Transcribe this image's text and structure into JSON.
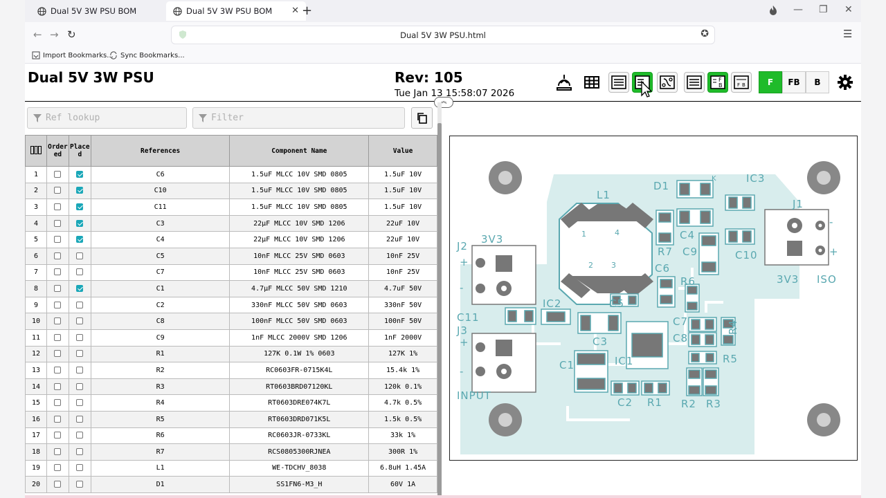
{
  "browser": {
    "tabs": [
      {
        "title": "Dual 5V 3W PSU BOM",
        "active": false
      },
      {
        "title": "Dual 5V 3W PSU BOM",
        "active": true
      }
    ],
    "url": "Dual 5V 3W PSU.html",
    "bookmarks": [
      "Import Bookmarks...",
      "Sync Bookmarks..."
    ]
  },
  "header": {
    "title": "Dual 5V 3W PSU",
    "revision": "Rev: 105",
    "date": "Tue Jan 13 15:58:07 2026"
  },
  "toolbar": {
    "layer_buttons": {
      "front": "F",
      "front_back": "FB",
      "back": "B"
    },
    "selected_layer": "F",
    "accent_color": "#1fbb2a"
  },
  "filters": {
    "ref_placeholder": "Ref lookup",
    "filter_placeholder": "Filter"
  },
  "bom": {
    "headers": {
      "ordered": "Ordered",
      "placed": "Placed",
      "references": "References",
      "component": "Component Name",
      "value": "Value"
    },
    "rows": [
      {
        "n": "1",
        "ordered": false,
        "placed": true,
        "ref": "C6",
        "name": "1.5uF MLCC 10V SMD 0805",
        "value": "1.5uF 10V"
      },
      {
        "n": "2",
        "ordered": false,
        "placed": true,
        "ref": "C10",
        "name": "1.5uF MLCC 10V SMD 0805",
        "value": "1.5uF 10V"
      },
      {
        "n": "3",
        "ordered": false,
        "placed": true,
        "ref": "C11",
        "name": "1.5uF MLCC 10V SMD 0805",
        "value": "1.5uF 10V"
      },
      {
        "n": "4",
        "ordered": false,
        "placed": true,
        "ref": "C3",
        "name": "22µF MLCC 10V SMD 1206",
        "value": "22uF 10V"
      },
      {
        "n": "5",
        "ordered": false,
        "placed": true,
        "ref": "C4",
        "name": "22µF MLCC 10V SMD 1206",
        "value": "22uF 10V"
      },
      {
        "n": "6",
        "ordered": false,
        "placed": false,
        "ref": "C5",
        "name": "10nF MLCC 25V SMD 0603",
        "value": "10nF 25V"
      },
      {
        "n": "7",
        "ordered": false,
        "placed": false,
        "ref": "C7",
        "name": "10nF MLCC 25V SMD 0603",
        "value": "10nF 25V"
      },
      {
        "n": "8",
        "ordered": false,
        "placed": true,
        "ref": "C1",
        "name": "4.7µF MLCC 50V SMD 1210",
        "value": "4.7uF 50V"
      },
      {
        "n": "9",
        "ordered": false,
        "placed": false,
        "ref": "C2",
        "name": "330nF MLCC 50V SMD 0603",
        "value": "330nF 50V"
      },
      {
        "n": "10",
        "ordered": false,
        "placed": false,
        "ref": "C8",
        "name": "100nF MLCC 50V SMD 0603",
        "value": "100nF 50V"
      },
      {
        "n": "11",
        "ordered": false,
        "placed": false,
        "ref": "C9",
        "name": "1nF MLCC 2000V SMD 1206",
        "value": "1nF 2000V"
      },
      {
        "n": "12",
        "ordered": false,
        "placed": false,
        "ref": "R1",
        "name": "127K 0.1W 1% 0603",
        "value": "127K 1%"
      },
      {
        "n": "13",
        "ordered": false,
        "placed": false,
        "ref": "R2",
        "name": "RC0603FR-0715K4L",
        "value": "15.4k 1%"
      },
      {
        "n": "14",
        "ordered": false,
        "placed": false,
        "ref": "R3",
        "name": "RT0603BRD07120KL",
        "value": "120k 0.1%"
      },
      {
        "n": "15",
        "ordered": false,
        "placed": false,
        "ref": "R4",
        "name": "RT0603DRE074K7L",
        "value": "4.7k 0.5%"
      },
      {
        "n": "16",
        "ordered": false,
        "placed": false,
        "ref": "R5",
        "name": "RT0603DRD071K5L",
        "value": "1.5k 0.5%"
      },
      {
        "n": "17",
        "ordered": false,
        "placed": false,
        "ref": "R6",
        "name": "RC0603JR-0733KL",
        "value": "33k 1%"
      },
      {
        "n": "18",
        "ordered": false,
        "placed": false,
        "ref": "R7",
        "name": "RCS0805300RJNEA",
        "value": "300R 1%"
      },
      {
        "n": "19",
        "ordered": false,
        "placed": false,
        "ref": "L1",
        "name": "WE-TDCHV_8038",
        "value": "6.8uH 1.45A"
      },
      {
        "n": "20",
        "ordered": false,
        "placed": false,
        "ref": "D1",
        "name": "SS1FN6-M3_H",
        "value": "60V 1A"
      }
    ]
  },
  "pcb": {
    "labels": [
      "L1",
      "D1",
      "IC3",
      "J1",
      "3V3",
      "J2",
      "R7",
      "C4",
      "C9",
      "C10",
      "C6",
      "R6",
      "IC2",
      "C5",
      "C11",
      "J3",
      "C3",
      "C7",
      "C8",
      "R4",
      "IC1",
      "C1",
      "R5",
      "INPUT",
      "C2",
      "R1",
      "R2",
      "R3",
      "3V3",
      "ISO",
      "+",
      "-",
      "+",
      "-",
      "+",
      "-",
      "K",
      "1",
      "2",
      "3",
      "4"
    ],
    "board_color": "#d8eded",
    "silk_color": "#5aa8b0"
  }
}
